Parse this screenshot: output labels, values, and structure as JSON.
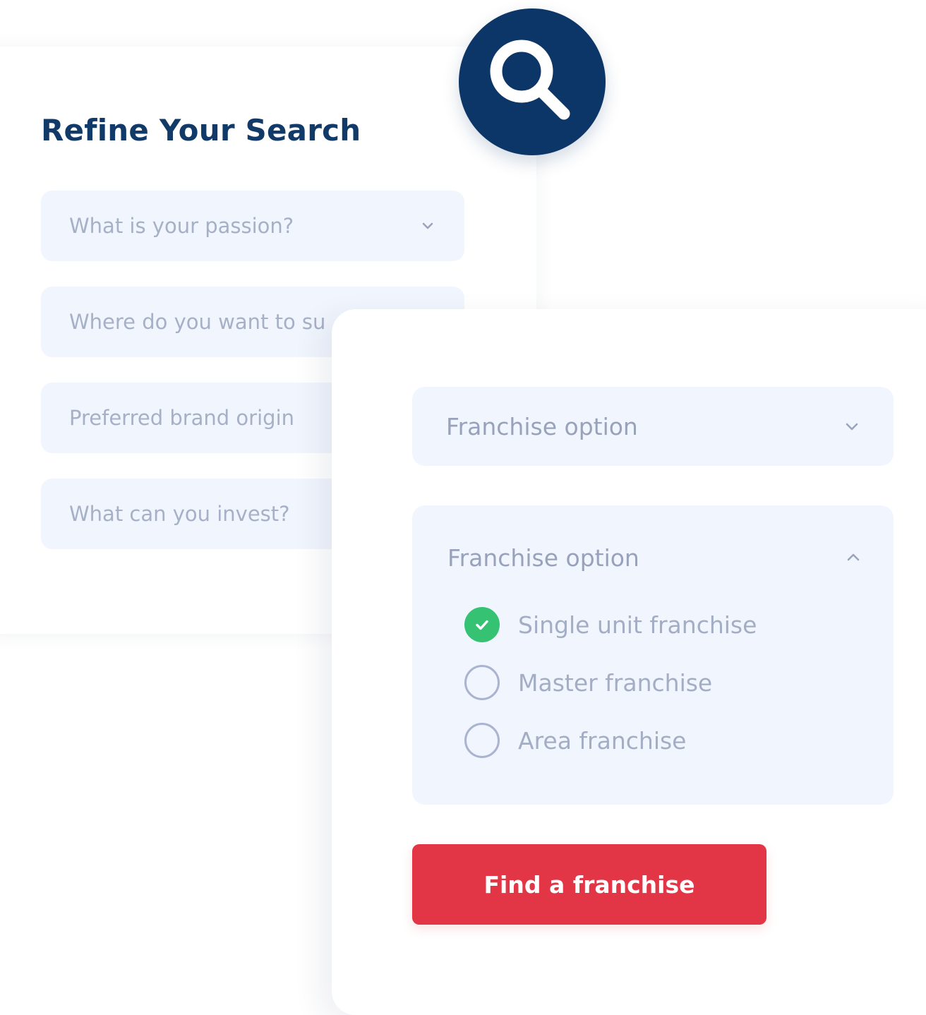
{
  "colors": {
    "brand_navy": "#0d3668",
    "title_navy": "#123a68",
    "field_background": "#f1f5fd",
    "placeholder_text": "#a6b0c6",
    "check_green": "#35c373",
    "button_red": "#e23545"
  },
  "search_badge": {
    "icon": "search-icon"
  },
  "refine": {
    "title": "Refine Your Search",
    "fields": [
      {
        "label": "What is your passion?",
        "icon": "chevron-down-icon"
      },
      {
        "label": "Where do you want to su"
      },
      {
        "label": "Preferred brand origin"
      },
      {
        "label": "What can you invest?"
      }
    ]
  },
  "franchise_select_closed": {
    "label": "Franchise option",
    "icon": "chevron-down-icon"
  },
  "franchise_select_open": {
    "label": "Franchise option",
    "icon": "chevron-up-icon",
    "options": [
      {
        "label": "Single unit franchise",
        "checked": true
      },
      {
        "label": "Master franchise",
        "checked": false
      },
      {
        "label": "Area franchise",
        "checked": false
      }
    ]
  },
  "cta": {
    "label": "Find a franchise"
  }
}
